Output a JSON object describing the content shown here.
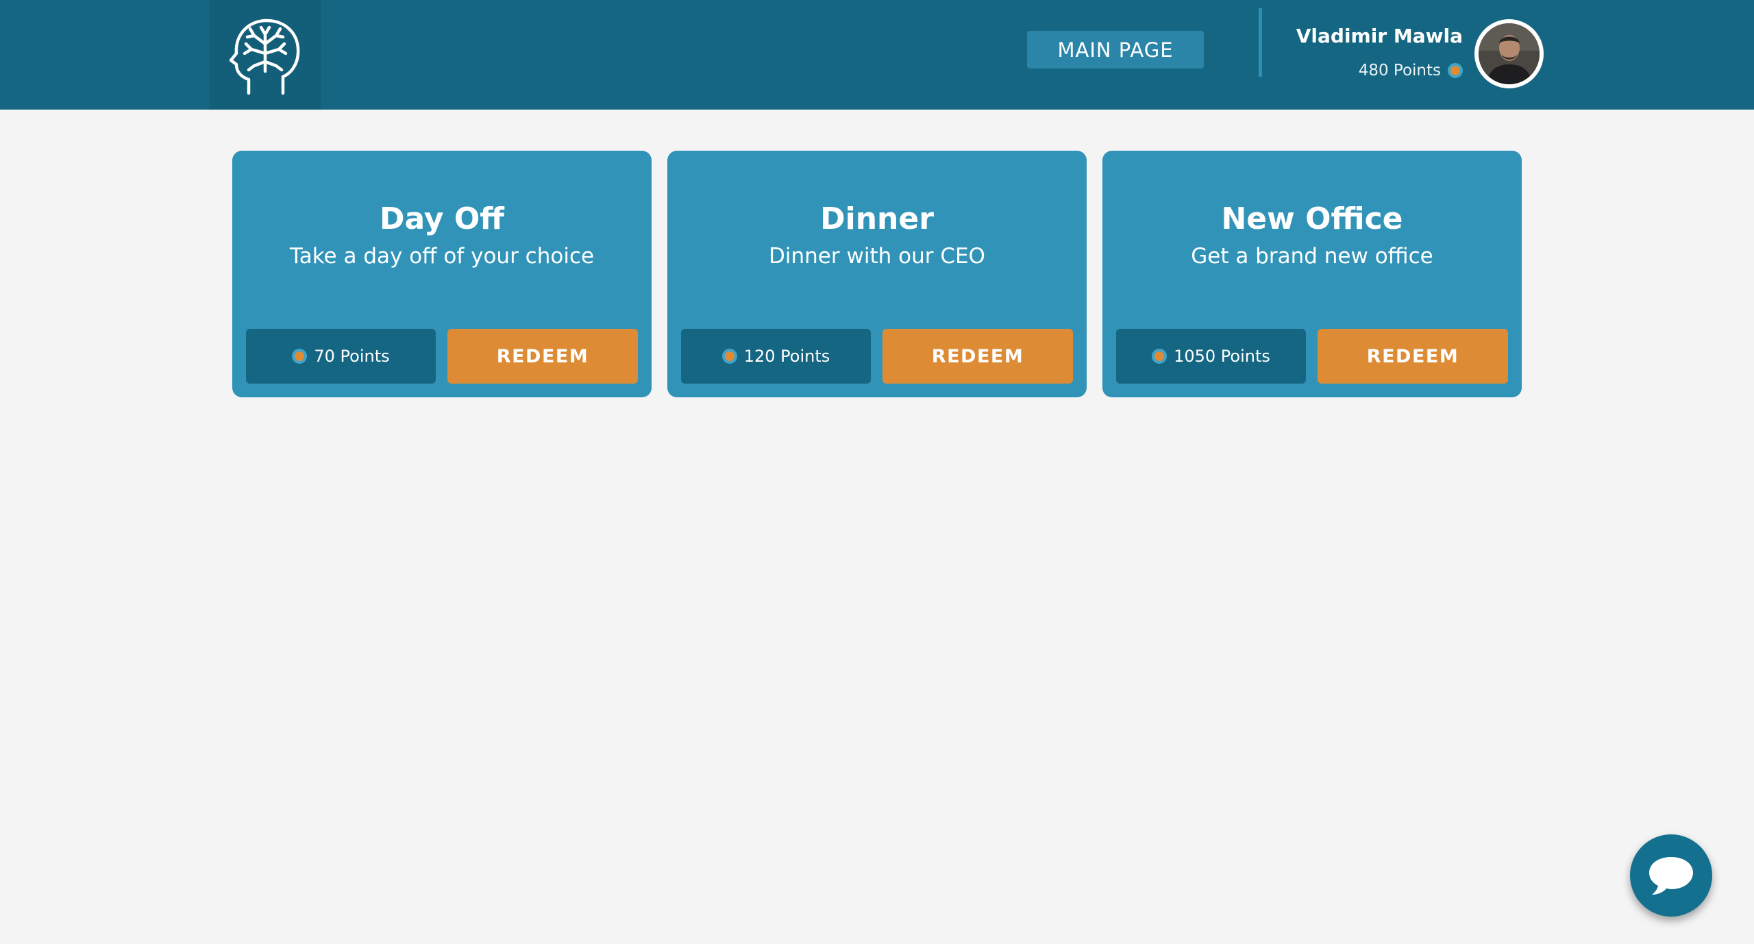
{
  "header": {
    "logo_icon": "brain-head-icon",
    "nav_button_label": "MAIN PAGE",
    "user": {
      "name": "Vladimir Mawla",
      "points": "480 Points",
      "avatar_icon": "avatar"
    }
  },
  "rewards": [
    {
      "title": "Day Off",
      "subtitle": "Take a day off of your choice",
      "points": "70 Points",
      "button": "REDEEM"
    },
    {
      "title": "Dinner",
      "subtitle": "Dinner with our CEO",
      "points": "120 Points",
      "button": "REDEEM"
    },
    {
      "title": "New Office",
      "subtitle": "Get a brand new office",
      "points": "1050 Points",
      "button": "REDEEM"
    }
  ],
  "chat": {
    "icon": "chat-bubble-icon"
  },
  "colors": {
    "header": "#156682",
    "card": "#3193b8",
    "pill": "#156682",
    "accent": "#de8b35",
    "background": "#f4f4f4"
  }
}
